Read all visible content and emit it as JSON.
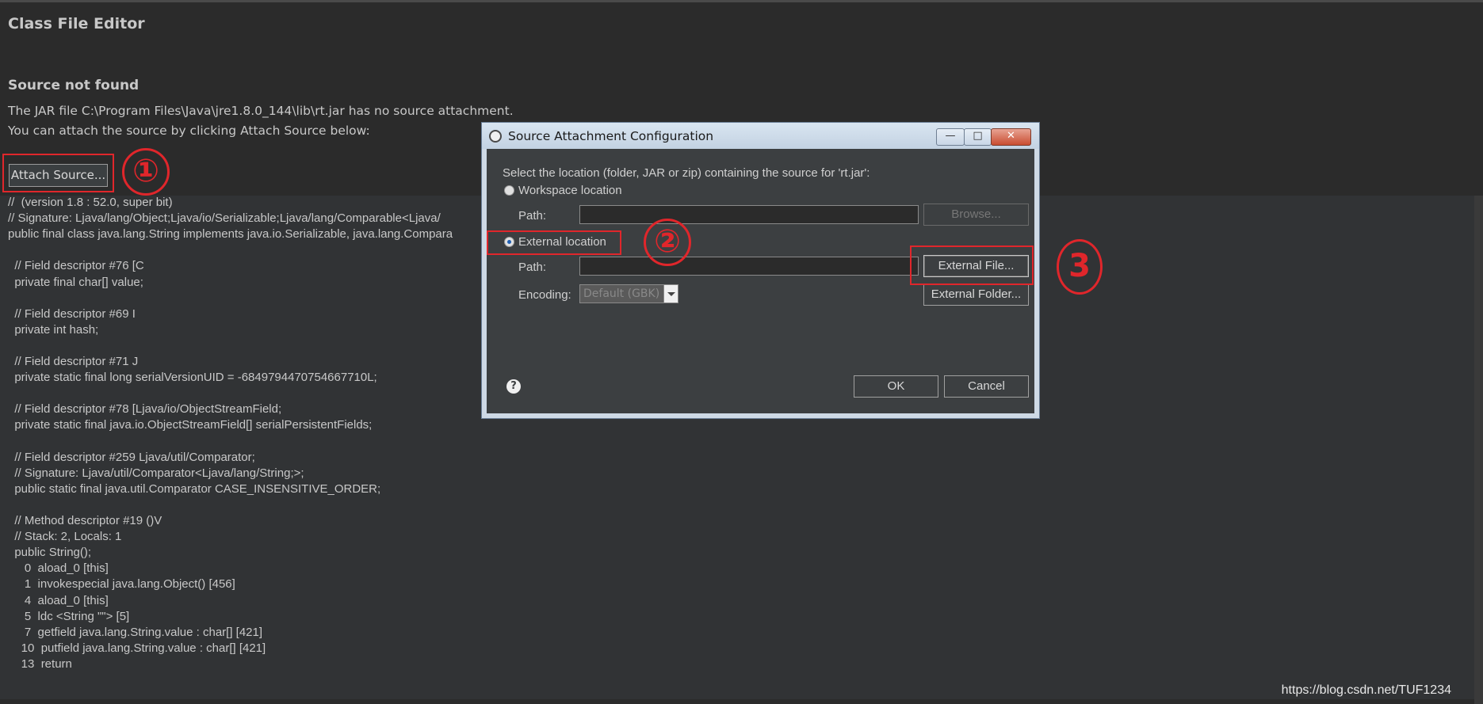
{
  "editor": {
    "title": "Class File Editor",
    "subtitle": "Source not found",
    "message_line1": "The JAR file C:\\Program Files\\Java\\jre1.8.0_144\\lib\\rt.jar has no source attachment.",
    "message_line2": "You can attach the source by clicking Attach Source below:",
    "attach_button": "Attach Source..."
  },
  "callouts": {
    "one": "①",
    "two": "②",
    "three": "3"
  },
  "code_lines": [
    "//  (version 1.8 : 52.0, super bit)",
    "// Signature: Ljava/lang/Object;Ljava/io/Serializable;Ljava/lang/Comparable<Ljava/",
    "public final class java.lang.String implements java.io.Serializable, java.lang.Compara",
    "",
    "  // Field descriptor #76 [C",
    "  private final char[] value;",
    "",
    "  // Field descriptor #69 I",
    "  private int hash;",
    "",
    "  // Field descriptor #71 J",
    "  private static final long serialVersionUID = -6849794470754667710L;",
    "",
    "  // Field descriptor #78 [Ljava/io/ObjectStreamField;",
    "  private static final java.io.ObjectStreamField[] serialPersistentFields;",
    "",
    "  // Field descriptor #259 Ljava/util/Comparator;",
    "  // Signature: Ljava/util/Comparator<Ljava/lang/String;>;",
    "  public static final java.util.Comparator CASE_INSENSITIVE_ORDER;",
    "",
    "  // Method descriptor #19 ()V",
    "  // Stack: 2, Locals: 1",
    "  public String();",
    "     0  aload_0 [this]",
    "     1  invokespecial java.lang.Object() [456]",
    "     4  aload_0 [this]",
    "     5  ldc <String \"\"> [5]",
    "     7  getfield java.lang.String.value : char[] [421]",
    "    10  putfield java.lang.String.value : char[] [421]",
    "    13  return"
  ],
  "dialog": {
    "title": "Source Attachment Configuration",
    "prompt": "Select the location (folder, JAR or zip) containing the source for 'rt.jar':",
    "workspace_radio": "Workspace location",
    "workspace_checked": false,
    "path_label": "Path:",
    "workspace_path_value": "",
    "browse_button": "Browse...",
    "external_radio": "External location",
    "external_checked": true,
    "external_path_value": "",
    "external_file_button": "External File...",
    "encoding_label": "Encoding:",
    "encoding_value": "Default (GBK)",
    "external_folder_button": "External Folder...",
    "ok_button": "OK",
    "cancel_button": "Cancel",
    "help_icon": "?"
  },
  "window_controls": {
    "minimize": "—",
    "maximize": "□",
    "close": "✕"
  },
  "watermark": "https://blog.csdn.net/TUF1234",
  "colors": {
    "annotation_red": "#e0262b",
    "editor_background": "#2b2b2b",
    "code_background": "#313335",
    "dialog_body": "#3c3f41"
  }
}
